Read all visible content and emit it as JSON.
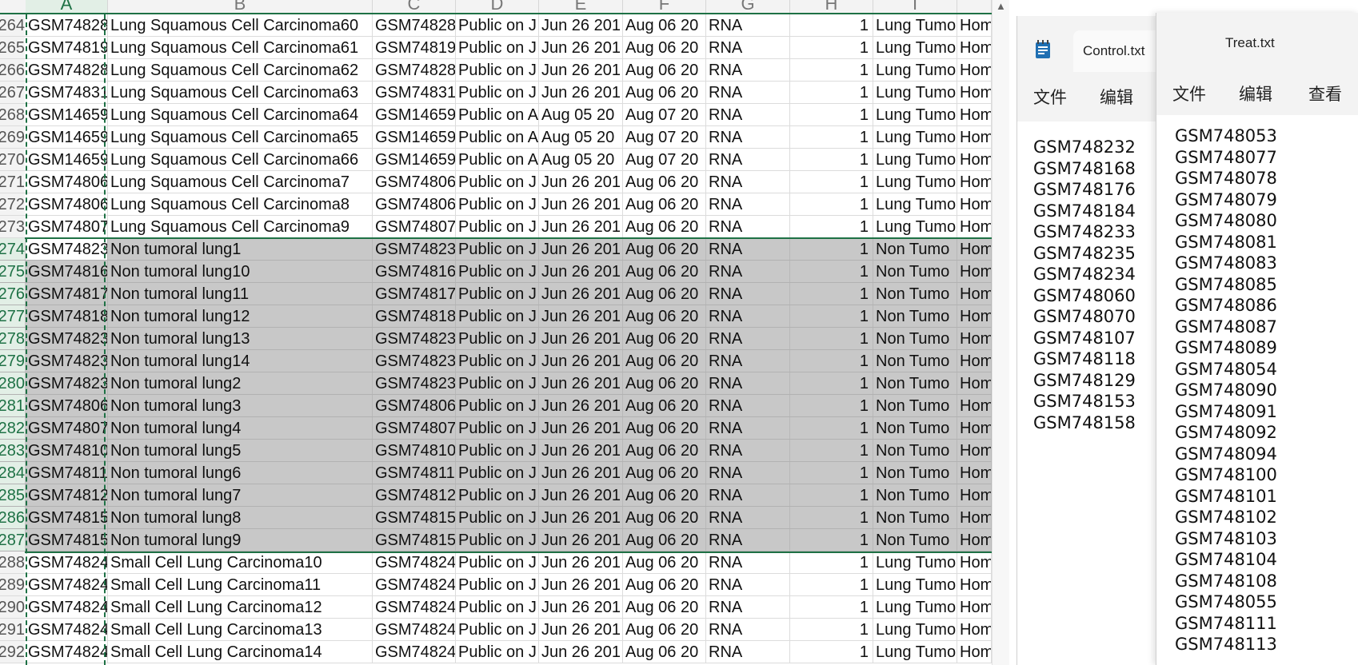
{
  "columns": [
    "A",
    "B",
    "C",
    "D",
    "E",
    "F",
    "G",
    "H",
    "I",
    ""
  ],
  "rows": [
    {
      "n": "264",
      "a": "GSM74828",
      "b": "Lung Squamous Cell Carcinoma60",
      "c": "GSM74828",
      "d": "Public on J",
      "e": "Jun 26 201",
      "f": "Aug 06 20",
      "g": "RNA",
      "h": "1",
      "i": "Lung Tumo",
      "j": "Hom",
      "sel": false
    },
    {
      "n": "265",
      "a": "GSM74819",
      "b": "Lung Squamous Cell Carcinoma61",
      "c": "GSM74819",
      "d": "Public on J",
      "e": "Jun 26 201",
      "f": "Aug 06 20",
      "g": "RNA",
      "h": "1",
      "i": "Lung Tumo",
      "j": "Hom",
      "sel": false
    },
    {
      "n": "266",
      "a": "GSM74828",
      "b": "Lung Squamous Cell Carcinoma62",
      "c": "GSM74828",
      "d": "Public on J",
      "e": "Jun 26 201",
      "f": "Aug 06 20",
      "g": "RNA",
      "h": "1",
      "i": "Lung Tumo",
      "j": "Hom",
      "sel": false
    },
    {
      "n": "267",
      "a": "GSM74831",
      "b": "Lung Squamous Cell Carcinoma63",
      "c": "GSM74831",
      "d": "Public on J",
      "e": "Jun 26 201",
      "f": "Aug 06 20",
      "g": "RNA",
      "h": "1",
      "i": "Lung Tumo",
      "j": "Hom",
      "sel": false
    },
    {
      "n": "268",
      "a": "GSM14659",
      "b": "Lung Squamous Cell Carcinoma64",
      "c": "GSM14659",
      "d": "Public on A",
      "e": "Aug 05 20",
      "f": "Aug 07 20",
      "g": "RNA",
      "h": "1",
      "i": "Lung Tumo",
      "j": "Hom",
      "sel": false
    },
    {
      "n": "269",
      "a": "GSM14659",
      "b": "Lung Squamous Cell Carcinoma65",
      "c": "GSM14659",
      "d": "Public on A",
      "e": "Aug 05 20",
      "f": "Aug 07 20",
      "g": "RNA",
      "h": "1",
      "i": "Lung Tumo",
      "j": "Hom",
      "sel": false
    },
    {
      "n": "270",
      "a": "GSM14659",
      "b": "Lung Squamous Cell Carcinoma66",
      "c": "GSM14659",
      "d": "Public on A",
      "e": "Aug 05 20",
      "f": "Aug 07 20",
      "g": "RNA",
      "h": "1",
      "i": "Lung Tumo",
      "j": "Hom",
      "sel": false
    },
    {
      "n": "271",
      "a": "GSM74806",
      "b": "Lung Squamous Cell Carcinoma7",
      "c": "GSM74806",
      "d": "Public on J",
      "e": "Jun 26 201",
      "f": "Aug 06 20",
      "g": "RNA",
      "h": "1",
      "i": "Lung Tumo",
      "j": "Hom",
      "sel": false
    },
    {
      "n": "272",
      "a": "GSM74806",
      "b": "Lung Squamous Cell Carcinoma8",
      "c": "GSM74806",
      "d": "Public on J",
      "e": "Jun 26 201",
      "f": "Aug 06 20",
      "g": "RNA",
      "h": "1",
      "i": "Lung Tumo",
      "j": "Hom",
      "sel": false
    },
    {
      "n": "273",
      "a": "GSM74807",
      "b": "Lung Squamous Cell Carcinoma9",
      "c": "GSM74807",
      "d": "Public on J",
      "e": "Jun 26 201",
      "f": "Aug 06 20",
      "g": "RNA",
      "h": "1",
      "i": "Lung Tumo",
      "j": "Hom",
      "sel": false
    },
    {
      "n": "274",
      "a": "GSM74823",
      "b": "Non tumoral lung1",
      "c": "GSM74823",
      "d": "Public on J",
      "e": "Jun 26 201",
      "f": "Aug 06 20",
      "g": "RNA",
      "h": "1",
      "i": "Non Tumo",
      "j": "Hom",
      "sel": true
    },
    {
      "n": "275",
      "a": "GSM74816",
      "b": "Non tumoral lung10",
      "c": "GSM74816",
      "d": "Public on J",
      "e": "Jun 26 201",
      "f": "Aug 06 20",
      "g": "RNA",
      "h": "1",
      "i": "Non Tumo",
      "j": "Hom",
      "sel": true
    },
    {
      "n": "276",
      "a": "GSM74817",
      "b": "Non tumoral lung11",
      "c": "GSM74817",
      "d": "Public on J",
      "e": "Jun 26 201",
      "f": "Aug 06 20",
      "g": "RNA",
      "h": "1",
      "i": "Non Tumo",
      "j": "Hom",
      "sel": true
    },
    {
      "n": "277",
      "a": "GSM74818",
      "b": "Non tumoral lung12",
      "c": "GSM74818",
      "d": "Public on J",
      "e": "Jun 26 201",
      "f": "Aug 06 20",
      "g": "RNA",
      "h": "1",
      "i": "Non Tumo",
      "j": "Hom",
      "sel": true
    },
    {
      "n": "278",
      "a": "GSM74823",
      "b": "Non tumoral lung13",
      "c": "GSM74823",
      "d": "Public on J",
      "e": "Jun 26 201",
      "f": "Aug 06 20",
      "g": "RNA",
      "h": "1",
      "i": "Non Tumo",
      "j": "Hom",
      "sel": true
    },
    {
      "n": "279",
      "a": "GSM74823",
      "b": "Non tumoral lung14",
      "c": "GSM74823",
      "d": "Public on J",
      "e": "Jun 26 201",
      "f": "Aug 06 20",
      "g": "RNA",
      "h": "1",
      "i": "Non Tumo",
      "j": "Hom",
      "sel": true
    },
    {
      "n": "280",
      "a": "GSM74823",
      "b": "Non tumoral lung2",
      "c": "GSM74823",
      "d": "Public on J",
      "e": "Jun 26 201",
      "f": "Aug 06 20",
      "g": "RNA",
      "h": "1",
      "i": "Non Tumo",
      "j": "Hom",
      "sel": true
    },
    {
      "n": "281",
      "a": "GSM74806",
      "b": "Non tumoral lung3",
      "c": "GSM74806",
      "d": "Public on J",
      "e": "Jun 26 201",
      "f": "Aug 06 20",
      "g": "RNA",
      "h": "1",
      "i": "Non Tumo",
      "j": "Hom",
      "sel": true
    },
    {
      "n": "282",
      "a": "GSM74807",
      "b": "Non tumoral lung4",
      "c": "GSM74807",
      "d": "Public on J",
      "e": "Jun 26 201",
      "f": "Aug 06 20",
      "g": "RNA",
      "h": "1",
      "i": "Non Tumo",
      "j": "Hom",
      "sel": true
    },
    {
      "n": "283",
      "a": "GSM74810",
      "b": "Non tumoral lung5",
      "c": "GSM74810",
      "d": "Public on J",
      "e": "Jun 26 201",
      "f": "Aug 06 20",
      "g": "RNA",
      "h": "1",
      "i": "Non Tumo",
      "j": "Hom",
      "sel": true
    },
    {
      "n": "284",
      "a": "GSM74811",
      "b": "Non tumoral lung6",
      "c": "GSM74811",
      "d": "Public on J",
      "e": "Jun 26 201",
      "f": "Aug 06 20",
      "g": "RNA",
      "h": "1",
      "i": "Non Tumo",
      "j": "Hom",
      "sel": true
    },
    {
      "n": "285",
      "a": "GSM74812",
      "b": "Non tumoral lung7",
      "c": "GSM74812",
      "d": "Public on J",
      "e": "Jun 26 201",
      "f": "Aug 06 20",
      "g": "RNA",
      "h": "1",
      "i": "Non Tumo",
      "j": "Hom",
      "sel": true
    },
    {
      "n": "286",
      "a": "GSM74815",
      "b": "Non tumoral lung8",
      "c": "GSM74815",
      "d": "Public on J",
      "e": "Jun 26 201",
      "f": "Aug 06 20",
      "g": "RNA",
      "h": "1",
      "i": "Non Tumo",
      "j": "Hom",
      "sel": true
    },
    {
      "n": "287",
      "a": "GSM74815",
      "b": "Non tumoral lung9",
      "c": "GSM74815",
      "d": "Public on J",
      "e": "Jun 26 201",
      "f": "Aug 06 20",
      "g": "RNA",
      "h": "1",
      "i": "Non Tumo",
      "j": "Hom",
      "sel": true
    },
    {
      "n": "288",
      "a": "GSM74824",
      "b": "Small Cell Lung Carcinoma10",
      "c": "GSM74824",
      "d": "Public on J",
      "e": "Jun 26 201",
      "f": "Aug 06 20",
      "g": "RNA",
      "h": "1",
      "i": "Lung Tumo",
      "j": "Hom",
      "sel": false
    },
    {
      "n": "289",
      "a": "GSM74824",
      "b": "Small Cell Lung Carcinoma11",
      "c": "GSM74824",
      "d": "Public on J",
      "e": "Jun 26 201",
      "f": "Aug 06 20",
      "g": "RNA",
      "h": "1",
      "i": "Lung Tumo",
      "j": "Hom",
      "sel": false
    },
    {
      "n": "290",
      "a": "GSM74824",
      "b": "Small Cell Lung Carcinoma12",
      "c": "GSM74824",
      "d": "Public on J",
      "e": "Jun 26 201",
      "f": "Aug 06 20",
      "g": "RNA",
      "h": "1",
      "i": "Lung Tumo",
      "j": "Hom",
      "sel": false
    },
    {
      "n": "291",
      "a": "GSM74824",
      "b": "Small Cell Lung Carcinoma13",
      "c": "GSM74824",
      "d": "Public on J",
      "e": "Jun 26 201",
      "f": "Aug 06 20",
      "g": "RNA",
      "h": "1",
      "i": "Lung Tumo",
      "j": "Hom",
      "sel": false
    },
    {
      "n": "292",
      "a": "GSM74824",
      "b": "Small Cell Lung Carcinoma14",
      "c": "GSM74824",
      "d": "Public on J",
      "e": "Jun 26 201",
      "f": "Aug 06 20",
      "g": "RNA",
      "h": "1",
      "i": "Lung Tumo",
      "j": "Hom",
      "sel": false
    }
  ],
  "control": {
    "tab_title": "Control.txt",
    "menu": [
      "文件",
      "编辑"
    ],
    "lines": [
      "GSM748232",
      "GSM748168",
      "GSM748176",
      "GSM748184",
      "GSM748233",
      "GSM748235",
      "GSM748234",
      "GSM748060",
      "GSM748070",
      "GSM748107",
      "GSM748118",
      "GSM748129",
      "GSM748153",
      "GSM748158"
    ]
  },
  "treat": {
    "tab_title": "Treat.txt",
    "menu": [
      "文件",
      "编辑",
      "查看"
    ],
    "lines": [
      "GSM748053",
      "GSM748077",
      "GSM748078",
      "GSM748079",
      "GSM748080",
      "GSM748081",
      "GSM748083",
      "GSM748085",
      "GSM748086",
      "GSM748087",
      "GSM748089",
      "GSM748054",
      "GSM748090",
      "GSM748091",
      "GSM748092",
      "GSM748094",
      "GSM748100",
      "GSM748101",
      "GSM748102",
      "GSM748103",
      "GSM748104",
      "GSM748108",
      "GSM748055",
      "GSM748111",
      "GSM748113"
    ]
  },
  "colors": {
    "accent": "#1e7145",
    "selection": "#c8c8c8",
    "notepad_icon": "#1f6fb2"
  }
}
